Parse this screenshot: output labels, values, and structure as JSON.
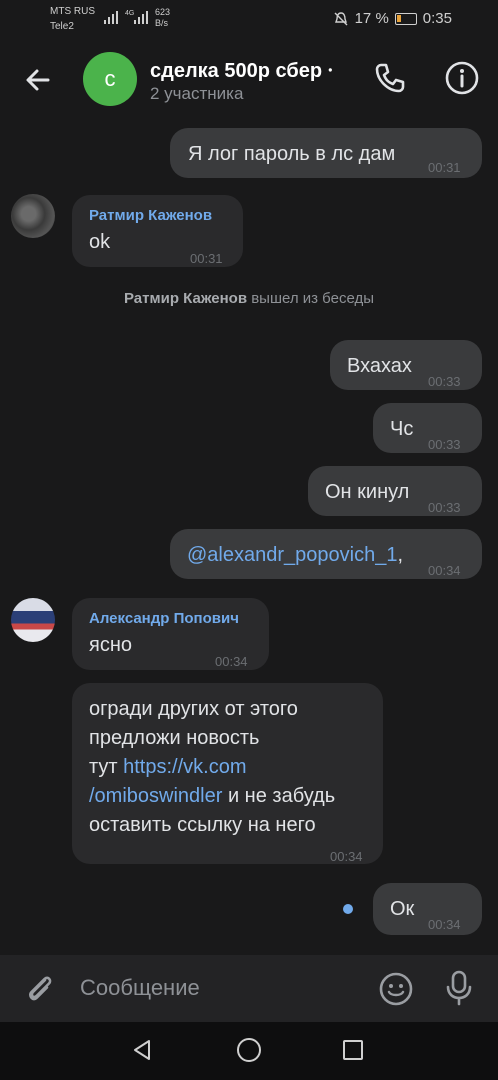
{
  "status_bar": {
    "operator1": "MTS RUS",
    "operator2": "Tele2",
    "network": "4G",
    "speed_value": "623",
    "speed_unit": "B/s",
    "battery": "17 %",
    "clock": "0:35"
  },
  "header": {
    "avatar_letter": "с",
    "title": "сделка 500р сбер ⸱",
    "subtitle": "2 участника"
  },
  "messages": [
    {
      "text": "Я лог пароль в лс дам",
      "time": "00:31"
    },
    {
      "sender": "Ратмир Каженов",
      "text": "ok",
      "time": "00:31"
    },
    {
      "system_name": "Ратмир Каженов",
      "system_text": " вышел из беседы"
    },
    {
      "text": "Вхахах",
      "time": "00:33"
    },
    {
      "text": "Чс",
      "time": "00:33"
    },
    {
      "text": "Он кинул",
      "time": "00:33"
    },
    {
      "mention": "@alexandr_popovich_1",
      "suffix": ",",
      "time": "00:34"
    },
    {
      "sender": "Александр Попович",
      "text": "ясно",
      "time": "00:34"
    },
    {
      "line1": "огради других от этого",
      "line2": "предложи новость",
      "line3_pre": "тут ",
      "link1": "https://vk.com",
      "link2": "/omiboswindler",
      "line4_post": " и не забудь",
      "line5": "оставить ссылку на него",
      "time": "00:34"
    },
    {
      "text": "Ок",
      "time": "00:34"
    }
  ],
  "composer": {
    "placeholder": "Сообщение"
  },
  "colors": {
    "background": "#19191a",
    "accent": "#71aaeb",
    "chat_avatar": "#4bb34b"
  },
  "icons": [
    "back-arrow-icon",
    "phone-icon",
    "info-icon",
    "paperclip-icon",
    "smile-icon",
    "microphone-icon"
  ]
}
